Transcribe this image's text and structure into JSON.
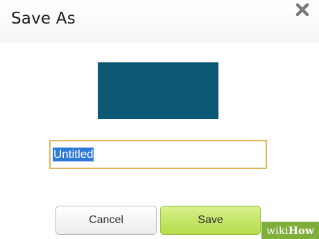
{
  "dialog": {
    "title": "Save As",
    "close_icon": "close-icon",
    "preview_color": "#0b5874",
    "name_field": {
      "value": "Untitled",
      "selected": true
    },
    "buttons": {
      "cancel_label": "Cancel",
      "save_label": "Save"
    }
  },
  "watermark": {
    "part1": "wiki",
    "part2": "How"
  },
  "colors": {
    "accent_save": "#b5dc4a",
    "input_focus_border": "#e0b45a",
    "selection_highlight": "#2f7ad8"
  }
}
